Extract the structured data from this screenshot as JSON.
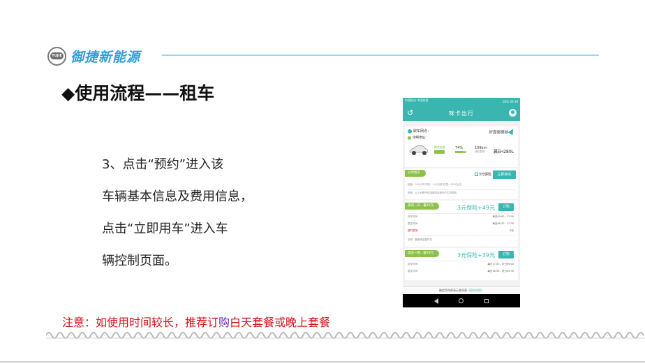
{
  "brand": {
    "logo_badge_text": "YUJIE",
    "name": "御捷新能源"
  },
  "slide": {
    "title": "◆使用流程——租车",
    "body_lines": [
      "3、点击“预约”进入该",
      "车辆基本信息及费用信息，",
      "点击“立即用车”进入车",
      "辆控制页面。"
    ],
    "note_prefix": "注意：如使用时间较长，推荐订",
    "note_highlight": "购",
    "note_suffix": "白天套餐或晚上套餐"
  },
  "phone": {
    "status_left": "中国移动 中国联通",
    "status_right": "60% 09:39",
    "app_title": "咪卡出行",
    "pickup_label": "取车网点：",
    "pickup_value": "好嘉御捷城",
    "address_label": "详细地址：",
    "battery_label": "剩余电量",
    "battery_pct": "74%",
    "battery_level": 0.74,
    "range_value": "109km",
    "range_sub": "续航里程",
    "plate": "冀EH280L",
    "time_tag": "分时租车",
    "insurance_text": "3元保险",
    "use_now_button": "立即用车",
    "time_row": "起租：0.5/小时     时长：0.5/分钟     封顶：99.0元/天",
    "time_note": "说明：以上价格不包括保险及部分产生的损费",
    "package1": {
      "tag": "美试一白...餐49元",
      "price": "3元保险+49元",
      "order_button": "订购",
      "rows": [
        {
          "label": "用车时间：",
          "value": "每日09:00 - 17:00"
        },
        {
          "label": "限定时间：",
          "value": "每日08:30 - 17:30"
        }
      ],
      "over_label": "超时费用：",
      "over_value": "3元",
      "desc": "说明：套餐用量暂时仅"
    },
    "package2": {
      "tag": "美试一晚...餐39元",
      "price": "3元保险+39元",
      "order_button": "订购",
      "rows": [
        {
          "label": "用车时间：",
          "value": "每日17:00 - 次日09:00"
        },
        {
          "label": "限定时间：",
          "value": "每日16:30 - 次日09:30"
        }
      ]
    },
    "footer_text": "确定用车即表示我同意",
    "footer_link": "《租车须知》"
  }
}
